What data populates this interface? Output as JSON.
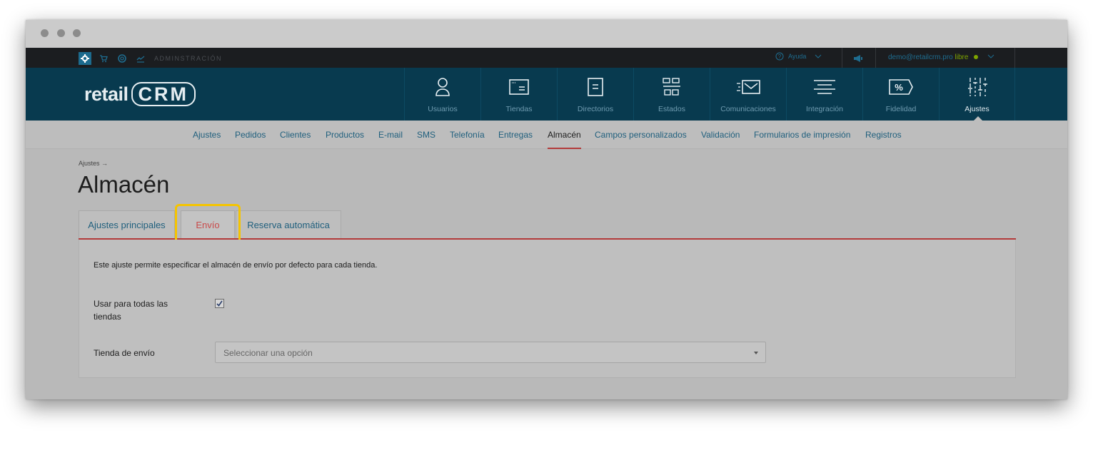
{
  "topbar": {
    "admin_label": "ADMINSTRACIÓN",
    "help_label": "Ayuda",
    "user_email": "demo@retailcrm.pro",
    "user_plan": "libre"
  },
  "logo": {
    "text_retail": "retail",
    "text_crm": "CRM"
  },
  "mainnav": {
    "items": [
      {
        "label": "Usuarios",
        "icon": "user-icon"
      },
      {
        "label": "Tiendas",
        "icon": "store-window-icon"
      },
      {
        "label": "Directorios",
        "icon": "document-icon"
      },
      {
        "label": "Estados",
        "icon": "status-grid-icon"
      },
      {
        "label": "Comunicaciones",
        "icon": "mail-icon"
      },
      {
        "label": "Integración",
        "icon": "integration-lines-icon"
      },
      {
        "label": "Fidelidad",
        "icon": "percent-tag-icon"
      },
      {
        "label": "Ajustes",
        "icon": "sliders-icon"
      }
    ]
  },
  "subnav": {
    "items": [
      "Ajustes",
      "Pedidos",
      "Clientes",
      "Productos",
      "E-mail",
      "SMS",
      "Telefonía",
      "Entregas",
      "Almacén",
      "Campos personalizados",
      "Validación",
      "Formularios de impresión",
      "Registros"
    ],
    "active": "Almacén"
  },
  "page": {
    "breadcrumb": "Ajustes →",
    "title": "Almacén"
  },
  "tabs": {
    "items": [
      "Ajustes principales",
      "Envío",
      "Reserva automática"
    ],
    "active": "Envío"
  },
  "form": {
    "description": "Este ajuste permite especificar el almacén de envío por defecto para cada tienda.",
    "use_all_label": "Usar para todas las tiendas",
    "use_all_checked": true,
    "store_label": "Tienda de envío",
    "store_placeholder": "Seleccionar una opción"
  },
  "colors": {
    "accent_red": "#b33b3b",
    "nav_bg": "#083a4f",
    "highlight": "#f5c400",
    "link_blue": "#1f5f7d"
  }
}
